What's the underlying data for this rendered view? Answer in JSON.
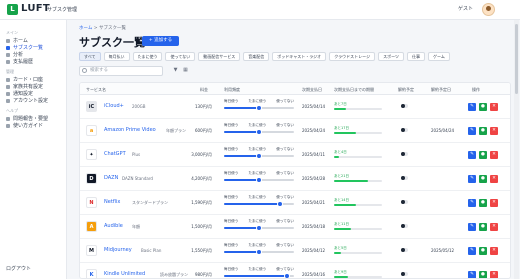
{
  "app": {
    "logo_mark": "L",
    "title": "LUFT",
    "subtitle": "サブスク管理",
    "user_name": "ゲスト"
  },
  "sidebar": {
    "sections": [
      {
        "label": "メイン",
        "items": [
          {
            "label": "ホーム"
          },
          {
            "label": "サブスク一覧",
            "active": true
          },
          {
            "label": "分析"
          },
          {
            "label": "支払履歴"
          }
        ]
      },
      {
        "label": "管理",
        "items": [
          {
            "label": "カード・口座"
          },
          {
            "label": "家族共有設定"
          },
          {
            "label": "通知設定"
          },
          {
            "label": "アカウント設定"
          }
        ]
      },
      {
        "label": "ヘルプ",
        "items": [
          {
            "label": "問題報告・要望"
          },
          {
            "label": "使い方ガイド"
          }
        ]
      }
    ],
    "logout_label": "ログアウト"
  },
  "breadcrumb": {
    "home": "ホーム",
    "separator": " > ",
    "current": "サブスク一覧"
  },
  "page_title": "サブスク一覧",
  "add_button": "+ 追加する",
  "filters": [
    "すべて",
    "毎月払い",
    "たまに使う",
    "使ってない",
    "動画配信サービス",
    "音楽配信",
    "ポッドキャスト・ラジオ",
    "クラウドストレージ",
    "スポーツ",
    "仕事",
    "ゲーム"
  ],
  "search": {
    "placeholder": "検索する",
    "filter_icon": "funnel-icon",
    "grid_icon": "grid-icon"
  },
  "table": {
    "headers": [
      "サービス名",
      "料金",
      "利用頻度",
      "次期支払日",
      "次期支払日までの期間",
      "解約予定",
      "解約予定日",
      "操作"
    ],
    "option_labels": [
      "毎日使う",
      "たまに使う",
      "使ってない"
    ],
    "rows": [
      {
        "logo": "iC",
        "logo_color": "#e5e7eb",
        "logo_text_color": "#111827",
        "name": "iCloud+",
        "plan": "200GB",
        "fee": "130円/月",
        "usage_level": 0.5,
        "next_date": "2025/04/14",
        "remaining": "あと7日",
        "progress": 0.25,
        "cancel_date": ""
      },
      {
        "logo": "a",
        "logo_color": "#ffffff",
        "logo_text_color": "#f59e0b",
        "name": "Amazon Prime Video",
        "plan": "年額プラン",
        "fee": "600円/月",
        "usage_level": 0.5,
        "next_date": "2025/04/24",
        "remaining": "あと17日",
        "progress": 0.45,
        "cancel_date": "2025/04/24"
      },
      {
        "logo": "✦",
        "logo_color": "#ffffff",
        "logo_text_color": "#111827",
        "name": "ChatGPT",
        "plan": "Plus",
        "fee": "3,000円/月",
        "usage_level": 0.5,
        "next_date": "2025/04/11",
        "remaining": "あと4日",
        "progress": 0.1,
        "cancel_date": ""
      },
      {
        "logo": "D",
        "logo_color": "#111827",
        "logo_text_color": "#ffffff",
        "name": "DAZN",
        "plan": "DAZN Standard",
        "fee": "4,200円/月",
        "usage_level": 0.5,
        "next_date": "2025/04/28",
        "remaining": "あと21日",
        "progress": 0.7,
        "cancel_date": ""
      },
      {
        "logo": "N",
        "logo_color": "#ffffff",
        "logo_text_color": "#dc2626",
        "name": "Netflix",
        "plan": "スタンダードプラン",
        "fee": "1,590円/月",
        "usage_level": 0.8,
        "next_date": "2025/04/21",
        "remaining": "あと14日",
        "progress": 0.45,
        "cancel_date": ""
      },
      {
        "logo": "A",
        "logo_color": "#f59e0b",
        "logo_text_color": "#ffffff",
        "name": "Audible",
        "plan": "年額",
        "fee": "1,500円/月",
        "usage_level": 0.5,
        "next_date": "2025/04/18",
        "remaining": "あと11日",
        "progress": 0.35,
        "cancel_date": ""
      },
      {
        "logo": "M",
        "logo_color": "#ffffff",
        "logo_text_color": "#111827",
        "name": "Midjourney",
        "plan": "Basic Plan",
        "fee": "1,550円/月",
        "usage_level": 0.5,
        "next_date": "2025/04/12",
        "remaining": "あと5日",
        "progress": 0.15,
        "cancel_date": "2025/05/12"
      },
      {
        "logo": "K",
        "logo_color": "#ffffff",
        "logo_text_color": "#2563eb",
        "name": "Kindle Unlimited",
        "plan": "読み放題プラン",
        "fee": "980円/月",
        "usage_level": 0.9,
        "next_date": "2025/04/16",
        "remaining": "あと9日",
        "progress": 0.3,
        "cancel_date": ""
      }
    ]
  },
  "actions": {
    "edit_icon": "edit-icon",
    "view_icon": "view-icon",
    "delete_icon": "delete-icon"
  },
  "colors": {
    "accent": "#2563eb",
    "success": "#16a34a",
    "danger": "#ef4444",
    "brand": "#16a34a"
  }
}
